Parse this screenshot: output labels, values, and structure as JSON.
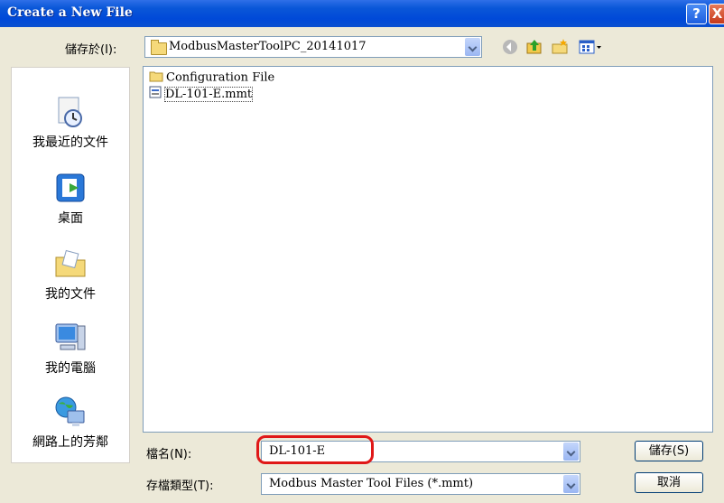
{
  "window": {
    "title": "Create a New File",
    "help_label": "?",
    "close_label": "X"
  },
  "save_in": {
    "label": "儲存於(I):",
    "value": "ModbusMasterToolPC_20141017"
  },
  "toolbar": {
    "icons": [
      "back-icon",
      "up-folder-icon",
      "new-folder-icon",
      "view-menu-icon"
    ]
  },
  "places": [
    {
      "label": "我最近的文件",
      "icon": "recent-documents-icon"
    },
    {
      "label": "桌面",
      "icon": "desktop-icon"
    },
    {
      "label": "我的文件",
      "icon": "my-documents-icon"
    },
    {
      "label": "我的電腦",
      "icon": "my-computer-icon"
    },
    {
      "label": "網路上的芳鄰",
      "icon": "network-places-icon"
    }
  ],
  "files": [
    {
      "name": "Configuration File",
      "type": "folder"
    },
    {
      "name": "DL-101-E.mmt",
      "type": "file"
    }
  ],
  "filename": {
    "label": "檔名(N):",
    "value": "DL-101-E"
  },
  "filetype": {
    "label": "存檔類型(T):",
    "value": "Modbus Master Tool Files (*.mmt)"
  },
  "buttons": {
    "save": "儲存(S)",
    "cancel": "取消"
  },
  "colors": {
    "titlebar": "#0a57d8",
    "dialog_bg": "#ece9d8",
    "highlight": "#e01818"
  }
}
